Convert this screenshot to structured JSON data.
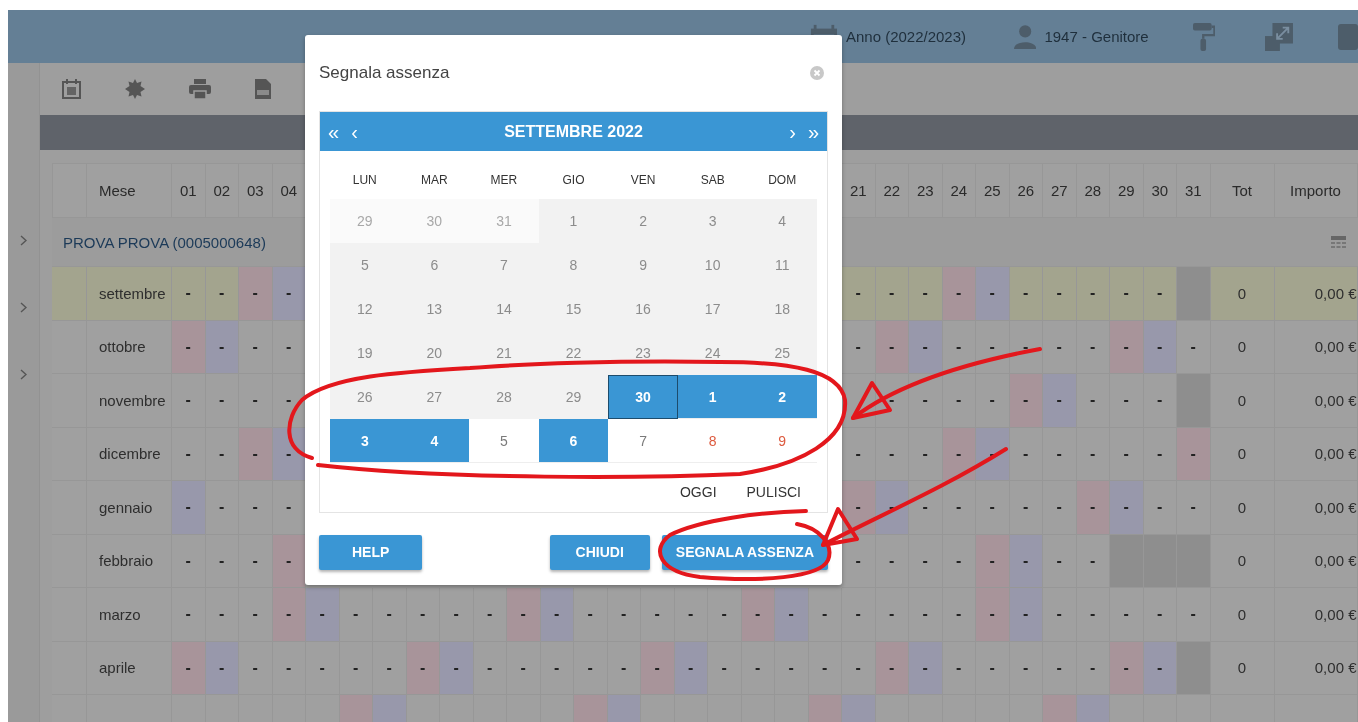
{
  "top_bar": {
    "year": "Anno (2022/2023)",
    "user": "1947 - Genitore"
  },
  "table": {
    "columns": {
      "month": "Mese",
      "days_start": [
        "01",
        "02",
        "03",
        "04"
      ],
      "days_end": [
        "21",
        "22",
        "23",
        "24",
        "25",
        "26",
        "27",
        "28",
        "29",
        "30",
        "31"
      ],
      "total": "Tot",
      "amount": "Importo"
    },
    "group": "PROVA PROVA (0005000648)",
    "rows": [
      {
        "month": "settembre",
        "highlight": true,
        "total": "0",
        "amount": "0,00 €",
        "days_start": [
          {
            "kind": "day",
            "text": "-"
          },
          {
            "kind": "day",
            "text": "-"
          },
          {
            "kind": "sat",
            "text": "-"
          },
          {
            "kind": "sun",
            "text": "-"
          }
        ],
        "days_end": [
          {
            "kind": "day",
            "text": "-"
          },
          {
            "kind": "day",
            "text": "-"
          },
          {
            "kind": "day",
            "text": "-"
          },
          {
            "kind": "sat",
            "text": "-"
          },
          {
            "kind": "sun",
            "text": "-"
          },
          {
            "kind": "day",
            "text": "-"
          },
          {
            "kind": "day",
            "text": "-"
          },
          {
            "kind": "day",
            "text": "-"
          },
          {
            "kind": "day",
            "text": "-"
          },
          {
            "kind": "day",
            "text": "-"
          },
          {
            "kind": "none"
          }
        ]
      },
      {
        "month": "ottobre",
        "highlight": false,
        "total": "0",
        "amount": "0,00 €",
        "days_start": [
          {
            "kind": "sat",
            "text": "-"
          },
          {
            "kind": "sun",
            "text": "-"
          },
          {
            "kind": "day",
            "text": "-"
          },
          {
            "kind": "day",
            "text": "-"
          }
        ],
        "days_end": [
          {
            "kind": "day",
            "text": "-"
          },
          {
            "kind": "sat",
            "text": "-"
          },
          {
            "kind": "sun",
            "text": "-"
          },
          {
            "kind": "day",
            "text": "-"
          },
          {
            "kind": "day",
            "text": "-"
          },
          {
            "kind": "day",
            "text": "-"
          },
          {
            "kind": "day",
            "text": "-"
          },
          {
            "kind": "day",
            "text": "-"
          },
          {
            "kind": "sat",
            "text": "-"
          },
          {
            "kind": "sun",
            "text": "-"
          },
          {
            "kind": "day",
            "text": "-"
          }
        ]
      },
      {
        "month": "novembre",
        "highlight": false,
        "total": "0",
        "amount": "0,00 €",
        "days_start": [
          {
            "kind": "day",
            "text": "-"
          },
          {
            "kind": "day",
            "text": "-"
          },
          {
            "kind": "day",
            "text": "-"
          },
          {
            "kind": "day",
            "text": "-"
          }
        ],
        "days_end": [
          {
            "kind": "day"
          },
          {
            "kind": "day",
            "text": "-"
          },
          {
            "kind": "day",
            "text": "-"
          },
          {
            "kind": "day",
            "text": "-"
          },
          {
            "kind": "day",
            "text": "-"
          },
          {
            "kind": "sat",
            "text": "-"
          },
          {
            "kind": "sun",
            "text": "-"
          },
          {
            "kind": "day",
            "text": "-"
          },
          {
            "kind": "day",
            "text": "-"
          },
          {
            "kind": "day",
            "text": "-"
          },
          {
            "kind": "none"
          }
        ]
      },
      {
        "month": "dicembre",
        "highlight": false,
        "total": "0",
        "amount": "0,00 €",
        "days_start": [
          {
            "kind": "day",
            "text": "-"
          },
          {
            "kind": "day",
            "text": "-"
          },
          {
            "kind": "sat",
            "text": "-"
          },
          {
            "kind": "sun",
            "text": "-"
          }
        ],
        "days_end": [
          {
            "kind": "day",
            "text": "-"
          },
          {
            "kind": "day",
            "text": "-"
          },
          {
            "kind": "day",
            "text": "-"
          },
          {
            "kind": "sat",
            "text": "-"
          },
          {
            "kind": "sun",
            "text": "-"
          },
          {
            "kind": "day",
            "text": "-"
          },
          {
            "kind": "day",
            "text": "-"
          },
          {
            "kind": "day",
            "text": "-"
          },
          {
            "kind": "day",
            "text": "-"
          },
          {
            "kind": "day",
            "text": "-"
          },
          {
            "kind": "sat",
            "text": "-"
          }
        ]
      },
      {
        "month": "gennaio",
        "highlight": false,
        "total": "0",
        "amount": "0,00 €",
        "days_start": [
          {
            "kind": "sun",
            "text": "-"
          },
          {
            "kind": "day",
            "text": "-"
          },
          {
            "kind": "day",
            "text": "-"
          },
          {
            "kind": "day",
            "text": "-"
          }
        ],
        "days_end": [
          {
            "kind": "sat",
            "text": "-"
          },
          {
            "kind": "sun",
            "text": "-"
          },
          {
            "kind": "day",
            "text": "-"
          },
          {
            "kind": "day",
            "text": "-"
          },
          {
            "kind": "day",
            "text": "-"
          },
          {
            "kind": "day",
            "text": "-"
          },
          {
            "kind": "day",
            "text": "-"
          },
          {
            "kind": "sat",
            "text": "-"
          },
          {
            "kind": "sun",
            "text": "-"
          },
          {
            "kind": "day",
            "text": "-"
          },
          {
            "kind": "day",
            "text": "-"
          }
        ]
      },
      {
        "month": "febbraio",
        "highlight": false,
        "total": "0",
        "amount": "0,00 €",
        "days_start": [
          {
            "kind": "day",
            "text": "-"
          },
          {
            "kind": "day",
            "text": "-"
          },
          {
            "kind": "day",
            "text": "-"
          },
          {
            "kind": "sat",
            "text": "-"
          }
        ],
        "days_end": [
          {
            "kind": "day",
            "text": "-"
          },
          {
            "kind": "day",
            "text": "-"
          },
          {
            "kind": "day",
            "text": "-"
          },
          {
            "kind": "day",
            "text": "-"
          },
          {
            "kind": "sat",
            "text": "-"
          },
          {
            "kind": "sun",
            "text": "-"
          },
          {
            "kind": "day",
            "text": "-"
          },
          {
            "kind": "day",
            "text": "-"
          },
          {
            "kind": "none"
          },
          {
            "kind": "none"
          },
          {
            "kind": "none"
          }
        ]
      },
      {
        "month": "marzo",
        "highlight": false,
        "total": "0",
        "amount": "0,00 €",
        "days": [
          {
            "kind": "day",
            "text": "-"
          },
          {
            "kind": "day",
            "text": "-"
          },
          {
            "kind": "day",
            "text": "-"
          },
          {
            "kind": "sat",
            "text": "-"
          },
          {
            "kind": "sun",
            "text": "-"
          },
          {
            "kind": "day",
            "text": "-"
          },
          {
            "kind": "day",
            "text": "-"
          },
          {
            "kind": "day",
            "text": "-"
          },
          {
            "kind": "day",
            "text": "-"
          },
          {
            "kind": "day",
            "text": "-"
          },
          {
            "kind": "sat",
            "text": "-"
          },
          {
            "kind": "sun",
            "text": "-"
          },
          {
            "kind": "day",
            "text": "-"
          },
          {
            "kind": "day",
            "text": "-"
          },
          {
            "kind": "day",
            "text": "-"
          },
          {
            "kind": "day",
            "text": "-"
          },
          {
            "kind": "day",
            "text": "-"
          },
          {
            "kind": "sat",
            "text": "-"
          },
          {
            "kind": "sun",
            "text": "-"
          },
          {
            "kind": "day",
            "text": "-"
          },
          {
            "kind": "day",
            "text": "-"
          },
          {
            "kind": "day",
            "text": "-"
          },
          {
            "kind": "day",
            "text": "-"
          },
          {
            "kind": "day",
            "text": "-"
          },
          {
            "kind": "sat",
            "text": "-"
          },
          {
            "kind": "sun",
            "text": "-"
          },
          {
            "kind": "day",
            "text": "-"
          },
          {
            "kind": "day",
            "text": "-"
          },
          {
            "kind": "day",
            "text": "-"
          },
          {
            "kind": "day",
            "text": "-"
          },
          {
            "kind": "day",
            "text": "-"
          }
        ]
      },
      {
        "month": "aprile",
        "highlight": false,
        "total": "0",
        "amount": "0,00 €",
        "days": [
          {
            "kind": "sat",
            "text": "-"
          },
          {
            "kind": "sun",
            "text": "-"
          },
          {
            "kind": "day",
            "text": "-"
          },
          {
            "kind": "day",
            "text": "-"
          },
          {
            "kind": "day",
            "text": "-"
          },
          {
            "kind": "day",
            "text": "-"
          },
          {
            "kind": "day",
            "text": "-"
          },
          {
            "kind": "sat",
            "text": "-"
          },
          {
            "kind": "sun",
            "text": "-"
          },
          {
            "kind": "day",
            "text": "-"
          },
          {
            "kind": "day",
            "text": "-"
          },
          {
            "kind": "day",
            "text": "-"
          },
          {
            "kind": "day",
            "text": "-"
          },
          {
            "kind": "day",
            "text": "-"
          },
          {
            "kind": "sat",
            "text": "-"
          },
          {
            "kind": "sun",
            "text": "-"
          },
          {
            "kind": "day",
            "text": "-"
          },
          {
            "kind": "day",
            "text": "-"
          },
          {
            "kind": "day",
            "text": "-"
          },
          {
            "kind": "day",
            "text": "-"
          },
          {
            "kind": "day",
            "text": "-"
          },
          {
            "kind": "sat",
            "text": "-"
          },
          {
            "kind": "sun",
            "text": "-"
          },
          {
            "kind": "day",
            "text": "-"
          },
          {
            "kind": "day",
            "text": "-"
          },
          {
            "kind": "day",
            "text": "-"
          },
          {
            "kind": "day",
            "text": "-"
          },
          {
            "kind": "day",
            "text": "-"
          },
          {
            "kind": "sat",
            "text": "-"
          },
          {
            "kind": "sun",
            "text": "-"
          },
          {
            "kind": "none"
          }
        ]
      },
      {
        "highlight": false,
        "days": [
          {
            "kind": "day"
          },
          {
            "kind": "day"
          },
          {
            "kind": "day"
          },
          {
            "kind": "day"
          },
          {
            "kind": "day"
          },
          {
            "kind": "sat"
          },
          {
            "kind": "sun"
          },
          {
            "kind": "day"
          },
          {
            "kind": "day"
          },
          {
            "kind": "day"
          },
          {
            "kind": "day"
          },
          {
            "kind": "day"
          },
          {
            "kind": "sat"
          },
          {
            "kind": "sun"
          },
          {
            "kind": "day"
          },
          {
            "kind": "day"
          },
          {
            "kind": "day"
          },
          {
            "kind": "day"
          },
          {
            "kind": "day"
          },
          {
            "kind": "sat"
          },
          {
            "kind": "sun"
          },
          {
            "kind": "day"
          },
          {
            "kind": "day"
          },
          {
            "kind": "day"
          },
          {
            "kind": "day"
          },
          {
            "kind": "day"
          },
          {
            "kind": "sat"
          },
          {
            "kind": "sun"
          },
          {
            "kind": "day"
          },
          {
            "kind": "day"
          },
          {
            "kind": "day"
          }
        ]
      }
    ]
  },
  "dialog": {
    "title": "Segnala assenza",
    "calendar": {
      "nav_left": [
        "«",
        "‹"
      ],
      "month": "SETTEMBRE 2022",
      "nav_right": [
        "›",
        "»"
      ],
      "weekdays": [
        "LUN",
        "MAR",
        "MER",
        "GIO",
        "VEN",
        "SAB",
        "DOM"
      ],
      "days": [
        {
          "text": "29",
          "kind": "other",
          "selected": false,
          "focused": false
        },
        {
          "text": "30",
          "kind": "other",
          "selected": false,
          "focused": false
        },
        {
          "text": "31",
          "kind": "other",
          "selected": false,
          "focused": false
        },
        {
          "text": "1",
          "kind": "past",
          "selected": false,
          "focused": false
        },
        {
          "text": "2",
          "kind": "past",
          "selected": false,
          "focused": false
        },
        {
          "text": "3",
          "kind": "past",
          "selected": false,
          "focused": false
        },
        {
          "text": "4",
          "kind": "past",
          "selected": false,
          "focused": false
        },
        {
          "text": "5",
          "kind": "past",
          "selected": false,
          "focused": false
        },
        {
          "text": "6",
          "kind": "past",
          "selected": false,
          "focused": false
        },
        {
          "text": "7",
          "kind": "past",
          "selected": false,
          "focused": false
        },
        {
          "text": "8",
          "kind": "past",
          "selected": false,
          "focused": false
        },
        {
          "text": "9",
          "kind": "past",
          "selected": false,
          "focused": false
        },
        {
          "text": "10",
          "kind": "past",
          "selected": false,
          "focused": false
        },
        {
          "text": "11",
          "kind": "past",
          "selected": false,
          "focused": false
        },
        {
          "text": "12",
          "kind": "past",
          "selected": false,
          "focused": false
        },
        {
          "text": "13",
          "kind": "past",
          "selected": false,
          "focused": false
        },
        {
          "text": "14",
          "kind": "past",
          "selected": false,
          "focused": false
        },
        {
          "text": "15",
          "kind": "past",
          "selected": false,
          "focused": false
        },
        {
          "text": "16",
          "kind": "past",
          "selected": false,
          "focused": false
        },
        {
          "text": "17",
          "kind": "past",
          "selected": false,
          "focused": false
        },
        {
          "text": "18",
          "kind": "past",
          "selected": false,
          "focused": false
        },
        {
          "text": "19",
          "kind": "past",
          "selected": false,
          "focused": false
        },
        {
          "text": "20",
          "kind": "past",
          "selected": false,
          "focused": false
        },
        {
          "text": "21",
          "kind": "past",
          "selected": false,
          "focused": false
        },
        {
          "text": "22",
          "kind": "past",
          "selected": false,
          "focused": false
        },
        {
          "text": "23",
          "kind": "past",
          "selected": false,
          "focused": false
        },
        {
          "text": "24",
          "kind": "past",
          "selected": false,
          "focused": false
        },
        {
          "text": "25",
          "kind": "past",
          "selected": false,
          "focused": false
        },
        {
          "text": "26",
          "kind": "past",
          "selected": false,
          "focused": false
        },
        {
          "text": "27",
          "kind": "past",
          "selected": false,
          "focused": false
        },
        {
          "text": "28",
          "kind": "past",
          "selected": false,
          "focused": false
        },
        {
          "text": "29",
          "kind": "past",
          "selected": false,
          "focused": false
        },
        {
          "text": "30",
          "kind": "past",
          "selected": true,
          "focused": true
        },
        {
          "text": "1",
          "kind": "next",
          "selected": true,
          "focused": false
        },
        {
          "text": "2",
          "kind": "next",
          "selected": true,
          "focused": false
        },
        {
          "text": "3",
          "kind": "next",
          "selected": true,
          "focused": false
        },
        {
          "text": "4",
          "kind": "next",
          "selected": true,
          "focused": false
        },
        {
          "text": "5",
          "kind": "next",
          "selected": false,
          "focused": false
        },
        {
          "text": "6",
          "kind": "next",
          "selected": true,
          "focused": false
        },
        {
          "text": "7",
          "kind": "next",
          "selected": false,
          "focused": false
        },
        {
          "text": "8",
          "kind": "weekend",
          "selected": false,
          "focused": false
        },
        {
          "text": "9",
          "kind": "weekend",
          "selected": false,
          "focused": false
        }
      ],
      "actions": [
        "OGGI",
        "PULISCI"
      ]
    },
    "buttons": [
      "HELP",
      "CHIUDI",
      "SEGNALA ASSENZA"
    ]
  }
}
